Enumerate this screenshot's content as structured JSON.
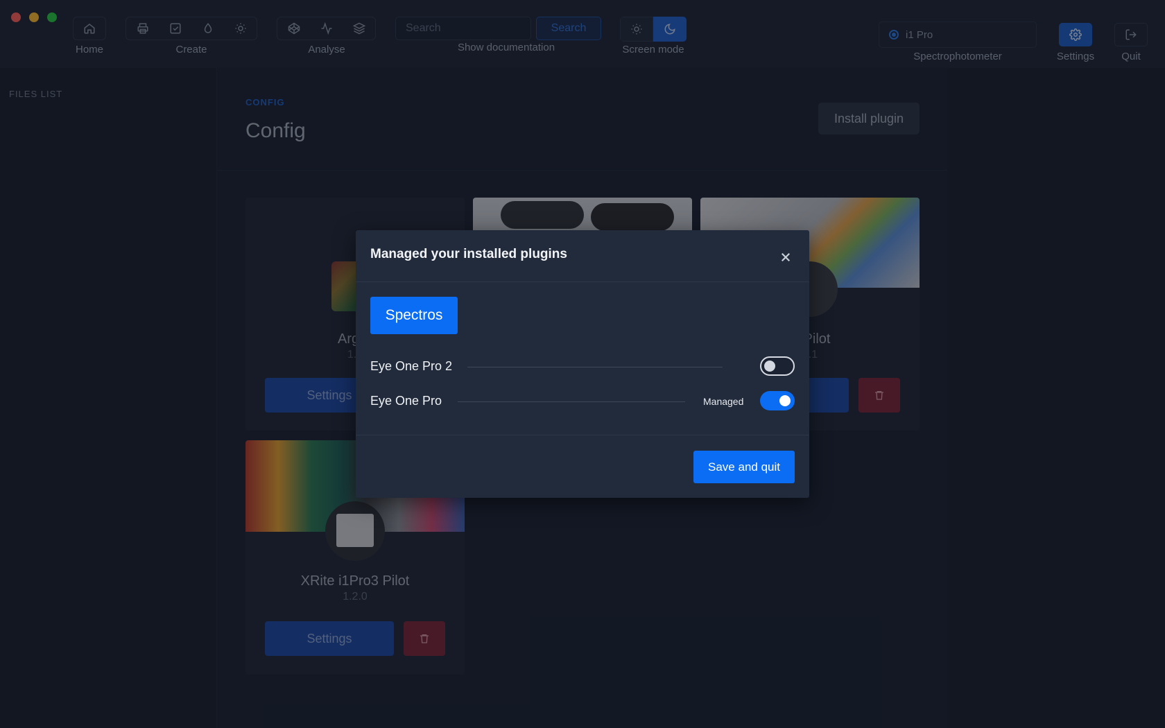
{
  "toolbar": {
    "groups": {
      "home": {
        "label": "Home"
      },
      "create": {
        "label": "Create"
      },
      "analyse": {
        "label": "Analyse"
      },
      "docs": {
        "label": "Show documentation"
      },
      "mode": {
        "label": "Screen mode"
      }
    },
    "search": {
      "placeholder": "Search",
      "button_label": "Search"
    },
    "spectro": {
      "value": "i1 Pro",
      "label": "Spectrophotometer"
    },
    "settings_label": "Settings",
    "quit_label": "Quit"
  },
  "sidebar": {
    "title": "FILES LIST"
  },
  "main": {
    "breadcrumb": "CONFIG",
    "title": "Config",
    "install_label": "Install plugin",
    "cards": [
      {
        "name": "Argyll",
        "version": "1.2",
        "settings_label": "Settings"
      },
      {
        "name": "",
        "version": "",
        "settings_label": ""
      },
      {
        "name": "D Pilot",
        "version": "2.1",
        "settings_label": ""
      },
      {
        "name": "XRite i1Pro3 Pilot",
        "version": "1.2.0",
        "settings_label": "Settings"
      }
    ]
  },
  "modal": {
    "title": "Managed your installed plugins",
    "tab_label": "Spectros",
    "plugins": [
      {
        "name": "Eye One Pro 2",
        "managed": false,
        "status_label": ""
      },
      {
        "name": "Eye One Pro",
        "managed": true,
        "status_label": "Managed"
      }
    ],
    "save_label": "Save and quit"
  },
  "colors": {
    "accent": "#0b6cf4",
    "background": "#181f2c",
    "danger": "#7a2636"
  }
}
